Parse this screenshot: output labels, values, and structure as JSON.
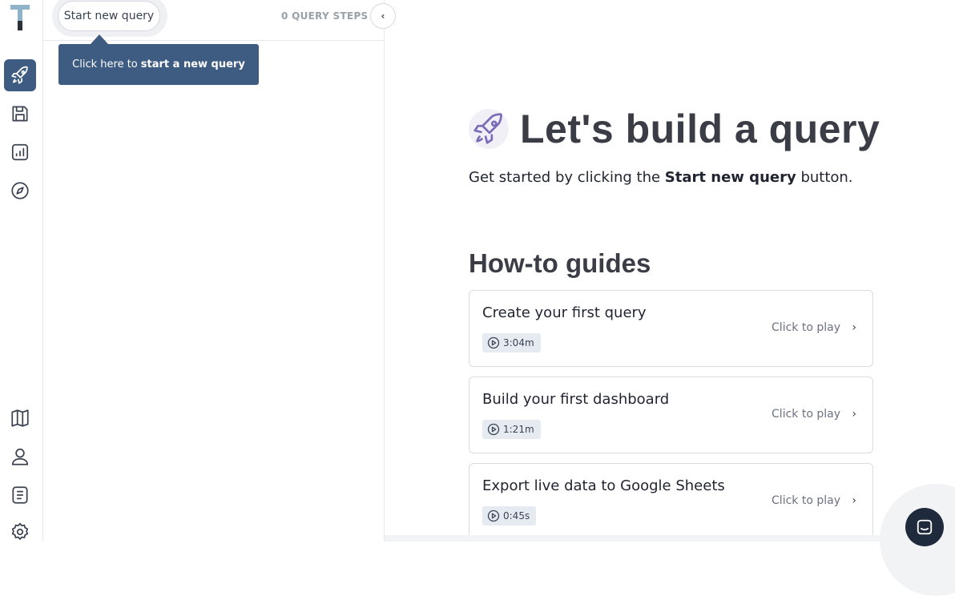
{
  "panel": {
    "start_button": "Start new query",
    "steps_label": "0 QUERY STEPS",
    "collapse_label": "‹"
  },
  "tooltip": {
    "prefix": "Click here to",
    "bold": "start a new query"
  },
  "main": {
    "title": "Let's build a query",
    "subtitle_prefix": "Get started by clicking the",
    "subtitle_bold": "Start new query",
    "subtitle_suffix": "button.",
    "guides_title": "How-to guides",
    "guides": [
      {
        "title": "Create your first query",
        "duration": "3:04m",
        "action": "Click to play"
      },
      {
        "title": "Build your first dashboard",
        "duration": "1:21m",
        "action": "Click to play"
      },
      {
        "title": "Export live data to Google Sheets",
        "duration": "0:45s",
        "action": "Click to play"
      }
    ]
  },
  "colors": {
    "accent": "#3e5b82",
    "heading": "#3a3d45",
    "rocket_purple": "#7b6bb8"
  },
  "icons": {
    "rail": [
      "rocket-icon",
      "save-icon",
      "chart-icon",
      "compass-icon",
      "book-icon",
      "user-icon",
      "document-icon",
      "gear-icon"
    ],
    "chat": "chat-icon"
  }
}
